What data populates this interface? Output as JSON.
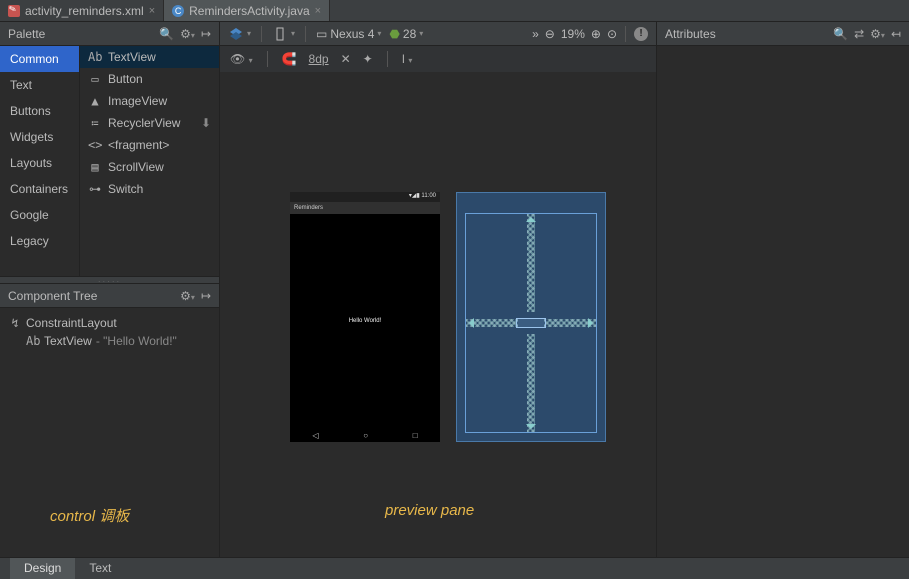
{
  "tabs": [
    {
      "label": "activity_reminders.xml",
      "type": "xml",
      "active": false
    },
    {
      "label": "RemindersActivity.java",
      "type": "java",
      "active": true
    }
  ],
  "palette": {
    "title": "Palette",
    "categories": [
      "Common",
      "Text",
      "Buttons",
      "Widgets",
      "Layouts",
      "Containers",
      "Google",
      "Legacy"
    ],
    "selectedCategory": "Common",
    "widgets": [
      {
        "icon": "Ab",
        "label": "TextView",
        "selected": true
      },
      {
        "icon": "▭",
        "label": "Button"
      },
      {
        "icon": "▲",
        "label": "ImageView"
      },
      {
        "icon": "≔",
        "label": "RecyclerView",
        "download": true
      },
      {
        "icon": "<>",
        "label": "<fragment>"
      },
      {
        "icon": "▤",
        "label": "ScrollView"
      },
      {
        "icon": "⊶",
        "label": "Switch"
      }
    ]
  },
  "tree": {
    "title": "Component Tree",
    "root": {
      "icon": "↯",
      "label": "ConstraintLayout"
    },
    "child": {
      "icon": "Ab",
      "label": "TextView",
      "value": "- \"Hello World!\""
    }
  },
  "toolbar": {
    "device": "Nexus 4",
    "api": "28",
    "zoom": "19%",
    "dp": "8dp"
  },
  "phone": {
    "title": "Reminders",
    "clock": "11:00",
    "content": "Hello World!"
  },
  "attributes": {
    "title": "Attributes"
  },
  "captions": {
    "control": "control 调板",
    "preview": "preview pane"
  },
  "bottomTabs": {
    "design": "Design",
    "text": "Text"
  }
}
